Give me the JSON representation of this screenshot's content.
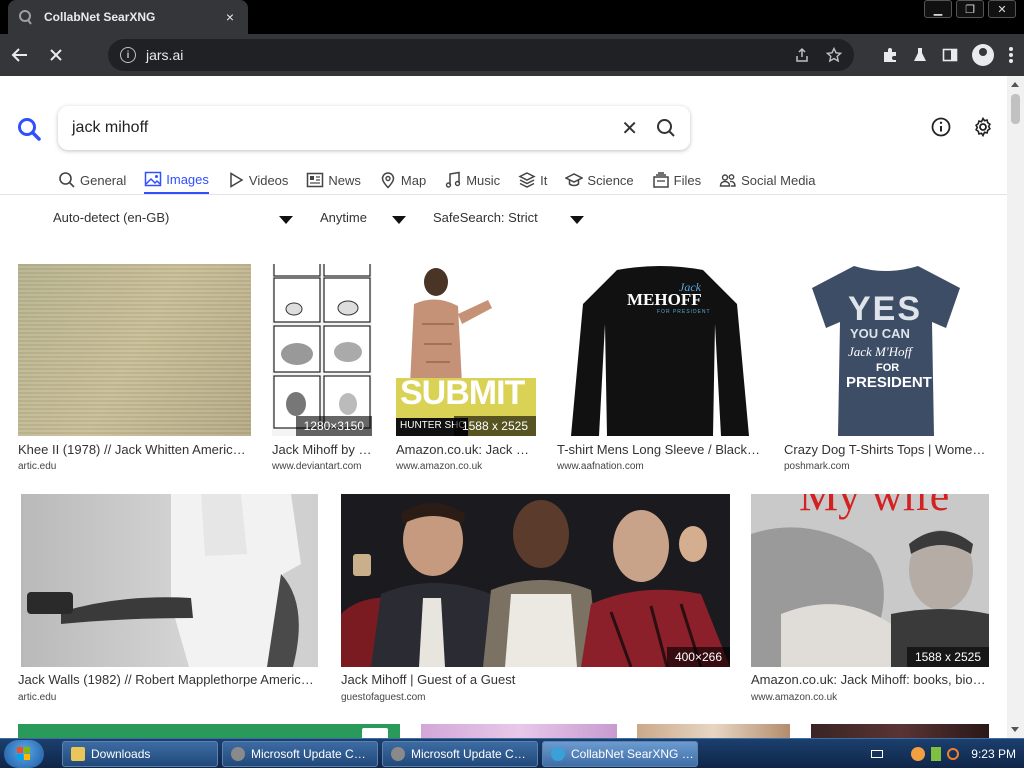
{
  "browser": {
    "tab_title": "CollabNet SearXNG",
    "tab_close": "×",
    "url": "jars.ai",
    "window_buttons": [
      "▁",
      "❐",
      "✕"
    ]
  },
  "search": {
    "query": "jack mihoff",
    "clear": "✕"
  },
  "categories": [
    {
      "label": "General",
      "icon": "search-icon",
      "active": false
    },
    {
      "label": "Images",
      "icon": "image-icon",
      "active": true
    },
    {
      "label": "Videos",
      "icon": "play-icon",
      "active": false
    },
    {
      "label": "News",
      "icon": "newspaper-icon",
      "active": false
    },
    {
      "label": "Map",
      "icon": "map-pin-icon",
      "active": false
    },
    {
      "label": "Music",
      "icon": "music-note-icon",
      "active": false
    },
    {
      "label": "It",
      "icon": "layers-icon",
      "active": false
    },
    {
      "label": "Science",
      "icon": "graduation-cap-icon",
      "active": false
    },
    {
      "label": "Files",
      "icon": "files-icon",
      "active": false
    },
    {
      "label": "Social Media",
      "icon": "people-icon",
      "active": false
    }
  ],
  "filters": {
    "language": "Auto-detect (en-GB)",
    "time": "Anytime",
    "safesearch": "SafeSearch: Strict"
  },
  "results": [
    {
      "title": "Khee II (1978) // Jack Whitten Americ…",
      "source": "artic.edu",
      "dims": ""
    },
    {
      "title": "Jack Mihoff by …",
      "source": "www.deviantart.com",
      "dims": "1280×3150"
    },
    {
      "title": "Amazon.co.uk: Jack …",
      "source": "www.amazon.co.uk",
      "dims": "1588 x 2525"
    },
    {
      "title": "T-shirt Mens Long Sleeve / Black…",
      "source": "www.aafnation.com",
      "dims": ""
    },
    {
      "title": "Crazy Dog T-Shirts Tops | Wome…",
      "source": "poshmark.com",
      "dims": ""
    },
    {
      "title": "Jack Walls (1982) // Robert Mapplethorpe Americ…",
      "source": "artic.edu",
      "dims": ""
    },
    {
      "title": "Jack Mihoff | Guest of a Guest",
      "source": "guestofaguest.com",
      "dims": "400×266"
    },
    {
      "title": "Amazon.co.uk: Jack Mihoff: books, bio…",
      "source": "www.amazon.co.uk",
      "dims": "1588 x 2525"
    }
  ],
  "image_text": {
    "submit": "SUBMIT",
    "hunter": "HUNTER SHO",
    "jack": "Jack",
    "mehoff": "MEHOFF",
    "for_president": "FOR PRESIDENT",
    "yes": "YES",
    "you_can": "YOU CAN",
    "jack_mhoff": "Jack M'Hoff",
    "for": "FOR",
    "president": "PRESIDENT",
    "my_wife": "My wife"
  },
  "taskbar": {
    "buttons": [
      {
        "label": "Downloads",
        "active": false
      },
      {
        "label": "Microsoft Update C…",
        "active": false
      },
      {
        "label": "Microsoft Update C…",
        "active": false
      },
      {
        "label": "CollabNet SearXNG …",
        "active": true
      }
    ],
    "clock": "9:23 PM"
  },
  "colors": {
    "accent": "#3050ff",
    "chrome_dark": "#35363a",
    "taskbar": "#1c3f6e"
  }
}
